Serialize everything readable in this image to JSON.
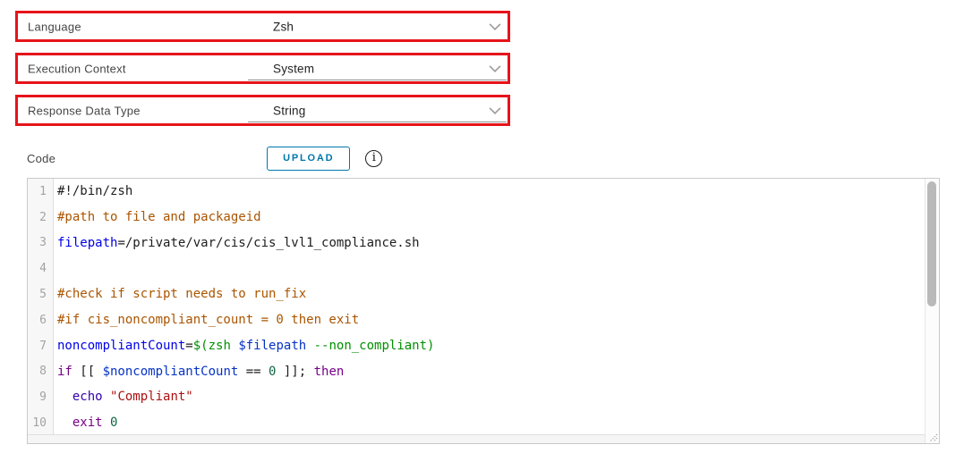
{
  "form": {
    "fields": [
      {
        "label": "Language",
        "value": "Zsh"
      },
      {
        "label": "Execution Context",
        "value": "System"
      },
      {
        "label": "Response Data Type",
        "value": "String"
      }
    ]
  },
  "code_section": {
    "label": "Code",
    "upload_button": "UPLOAD",
    "info_glyph": "i"
  },
  "colors": {
    "highlight_red": "#e6141a",
    "button_blue": "#0077ad",
    "chevron_gray": "#9b9b9b",
    "syntax": {
      "plain": "#1d1d1d",
      "comment": "#aa5500",
      "definition": "#0000e8",
      "variable": "#0533c4",
      "command_substitution": "#009000",
      "keyword": "#770088",
      "number": "#116644",
      "string": "#aa1111",
      "builtin": "#3300aa",
      "line_number": "#a3a3a3"
    }
  },
  "editor": {
    "lines": [
      {
        "n": "1",
        "tokens": [
          {
            "c": "plain",
            "t": "#!/bin/zsh"
          }
        ]
      },
      {
        "n": "2",
        "tokens": [
          {
            "c": "comment",
            "t": "#path to file and packageid"
          }
        ]
      },
      {
        "n": "3",
        "tokens": [
          {
            "c": "def",
            "t": "filepath"
          },
          {
            "c": "plain",
            "t": "=/private/var/cis/cis_lvl1_compliance.sh"
          }
        ]
      },
      {
        "n": "4",
        "tokens": []
      },
      {
        "n": "5",
        "tokens": [
          {
            "c": "comment",
            "t": "#check if script needs to run_fix"
          }
        ]
      },
      {
        "n": "6",
        "tokens": [
          {
            "c": "comment",
            "t": "#if cis_noncompliant_count = 0 then exit"
          }
        ]
      },
      {
        "n": "7",
        "tokens": [
          {
            "c": "def",
            "t": "noncompliantCount"
          },
          {
            "c": "plain",
            "t": "="
          },
          {
            "c": "quote",
            "t": "$(zsh "
          },
          {
            "c": "var",
            "t": "$filepath"
          },
          {
            "c": "quote",
            "t": " --non_compliant)"
          }
        ]
      },
      {
        "n": "8",
        "tokens": [
          {
            "c": "keyword",
            "t": "if"
          },
          {
            "c": "plain",
            "t": " [[ "
          },
          {
            "c": "var",
            "t": "$noncompliantCount"
          },
          {
            "c": "plain",
            "t": " == "
          },
          {
            "c": "number",
            "t": "0"
          },
          {
            "c": "plain",
            "t": " ]]; "
          },
          {
            "c": "keyword",
            "t": "then"
          }
        ]
      },
      {
        "n": "9",
        "tokens": [
          {
            "c": "plain",
            "t": "  "
          },
          {
            "c": "builtin",
            "t": "echo"
          },
          {
            "c": "plain",
            "t": " "
          },
          {
            "c": "string",
            "t": "\"Compliant\""
          }
        ]
      },
      {
        "n": "10",
        "tokens": [
          {
            "c": "plain",
            "t": "  "
          },
          {
            "c": "keyword",
            "t": "exit"
          },
          {
            "c": "plain",
            "t": " "
          },
          {
            "c": "number",
            "t": "0"
          }
        ]
      }
    ]
  }
}
